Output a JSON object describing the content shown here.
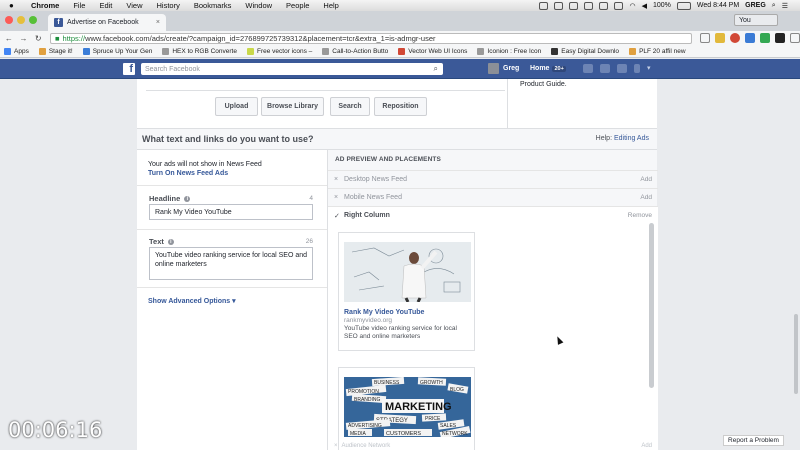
{
  "mac_menu": {
    "apple": "",
    "items": [
      "Chrome",
      "File",
      "Edit",
      "View",
      "History",
      "Bookmarks",
      "Window",
      "People",
      "Help"
    ],
    "battery": "100%",
    "clock": "Wed 8:44 PM",
    "user": "GREG"
  },
  "browser": {
    "tab_title": "Advertise on Facebook",
    "tab_close": "×",
    "profile": "You",
    "url_scheme": "https://",
    "url_rest": "www.facebook.com/ads/create/?campaign_id=276899725739312&placement=tcr&extra_1=is-admgr-user",
    "bookmarks": [
      "Apps",
      "Stage it!",
      "Spruce Up Your Gen",
      "HEX to RGB Converte",
      "Free vector icons –",
      "Call-to-Action Butto",
      "Vector Web UI Icons",
      "Iconion : Free Icon ",
      "Easy Digital Downlo",
      "PLF 20 affil new"
    ]
  },
  "fb": {
    "logo": "f",
    "search_placeholder": "Search Facebook",
    "user": "Greg",
    "home": "Home",
    "home_count": "20+"
  },
  "creative": {
    "buttons": [
      "Upload",
      "Browse Library",
      "Search",
      "Reposition"
    ],
    "guide_text": "Product Guide."
  },
  "section": {
    "title": "What text and links do you want to use?",
    "help_prefix": "Help:",
    "help_link": "Editing Ads"
  },
  "form": {
    "notice": "Your ads will not show in News Feed",
    "notice_link": "Turn On News Feed Ads",
    "headline_label": "Headline",
    "headline_count": "4",
    "headline_value": "Rank My Video YouTube",
    "text_label": "Text",
    "text_count": "26",
    "text_value": "YouTube video ranking service for local SEO and online marketers",
    "advanced_link": "Show Advanced Options ▾"
  },
  "preview": {
    "title": "AD PREVIEW AND PLACEMENTS",
    "placements": [
      {
        "name": "Desktop News Feed",
        "action": "Add",
        "mark": "×"
      },
      {
        "name": "Mobile News Feed",
        "action": "Add",
        "mark": "×"
      },
      {
        "name": "Right Column",
        "action": "Remove",
        "mark": "✓"
      }
    ],
    "ad_title": "Rank My Video YouTube",
    "ad_url": "rankmyvideo.org",
    "ad_text": "YouTube video ranking service for local SEO and online marketers",
    "bottom_row": "Audience Network",
    "bottom_action": "Add",
    "marketing_words": [
      "BUSINESS",
      "GROWTH",
      "PROMOTION",
      "BLOG",
      "BRANDING",
      "MARKETING",
      "PRICE",
      "STRATEGY",
      "SALES",
      "ADVERTISING",
      "NETWORK",
      "MEDIA",
      "CUSTOMERS"
    ]
  },
  "overlay": {
    "timer": "00:06:16",
    "report": "Report a Problem"
  }
}
